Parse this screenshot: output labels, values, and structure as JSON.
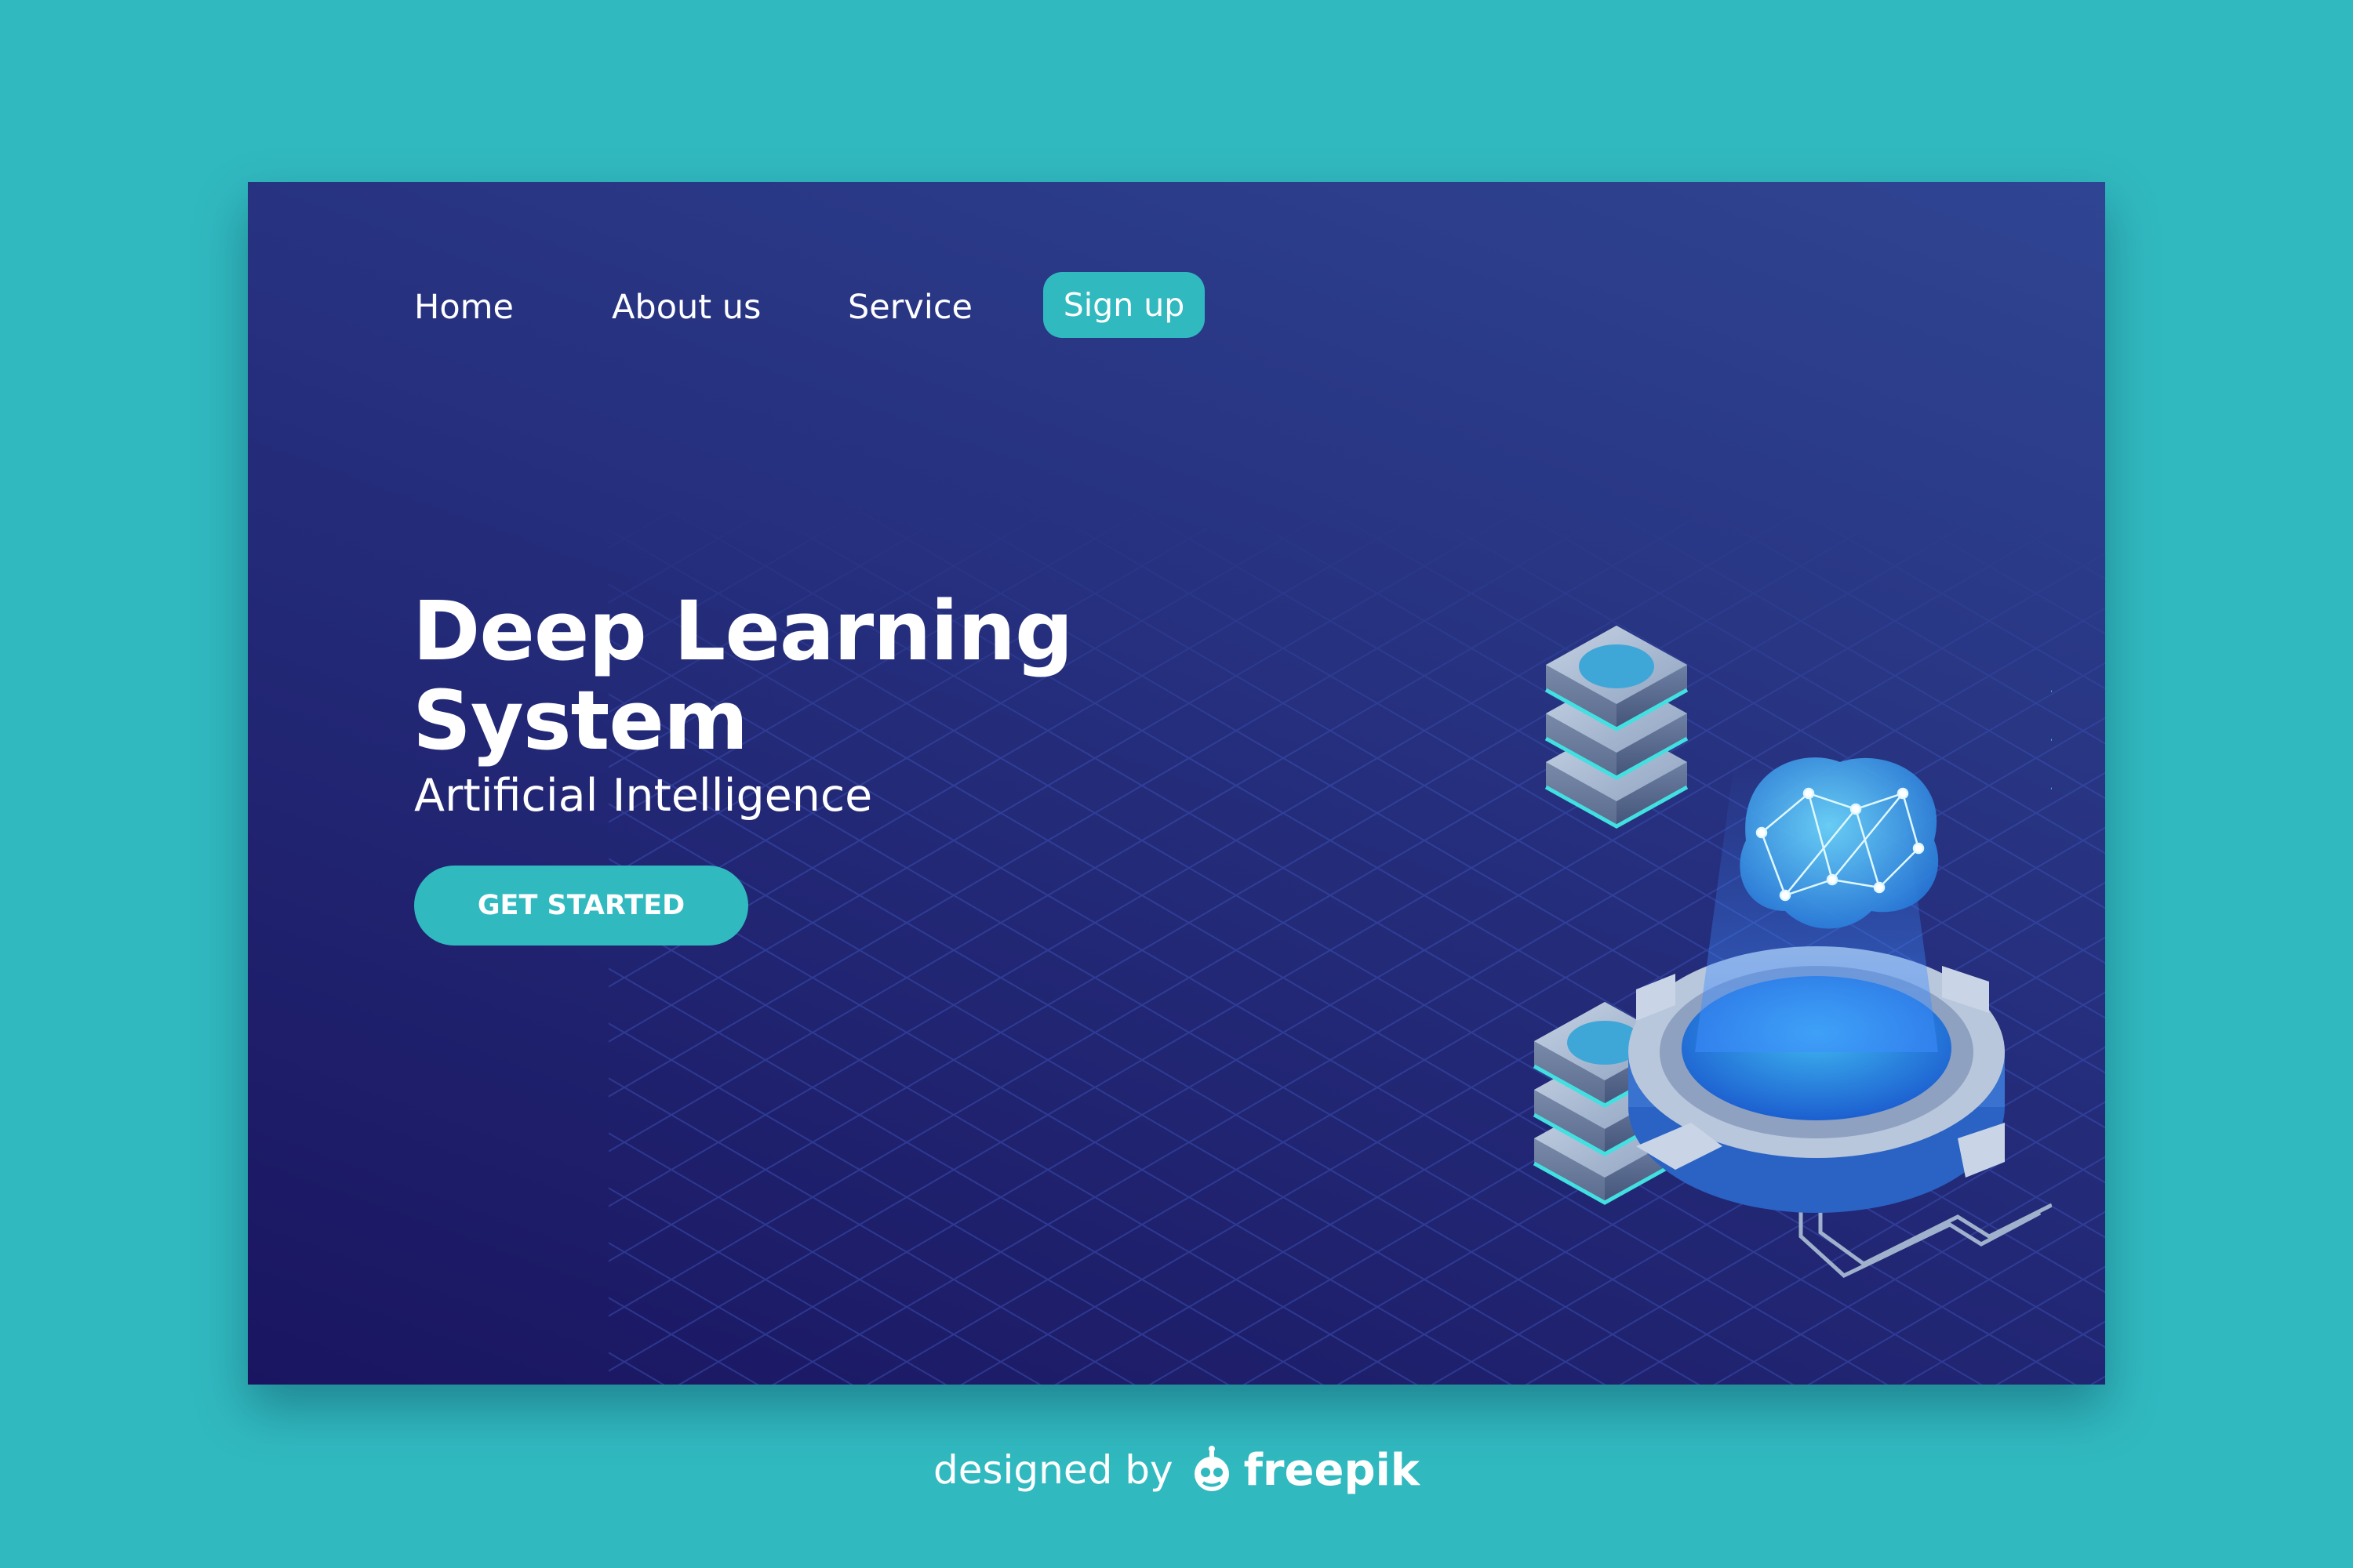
{
  "nav": {
    "home": "Home",
    "about": "About us",
    "service": "Service",
    "signup": "Sign up"
  },
  "hero": {
    "title_line1": "Deep Learning",
    "title_line2": "System",
    "subtitle": "Artificial Intelligence",
    "cta": "GET STARTED"
  },
  "credit": {
    "text": "designed by",
    "brand": "freepik",
    "logo_icon": "freepik-logo-icon"
  },
  "colors": {
    "page_background": "#31b9c0",
    "card_gradient_start": "#1a1560",
    "card_gradient_end": "#2f4593",
    "accent": "#31b9c0",
    "text": "#ffffff"
  },
  "illustration": {
    "icons": [
      "server-stack-icon",
      "brain-hologram-icon",
      "portal-platform-icon",
      "robot-hand-icon",
      "cable-icon"
    ]
  }
}
